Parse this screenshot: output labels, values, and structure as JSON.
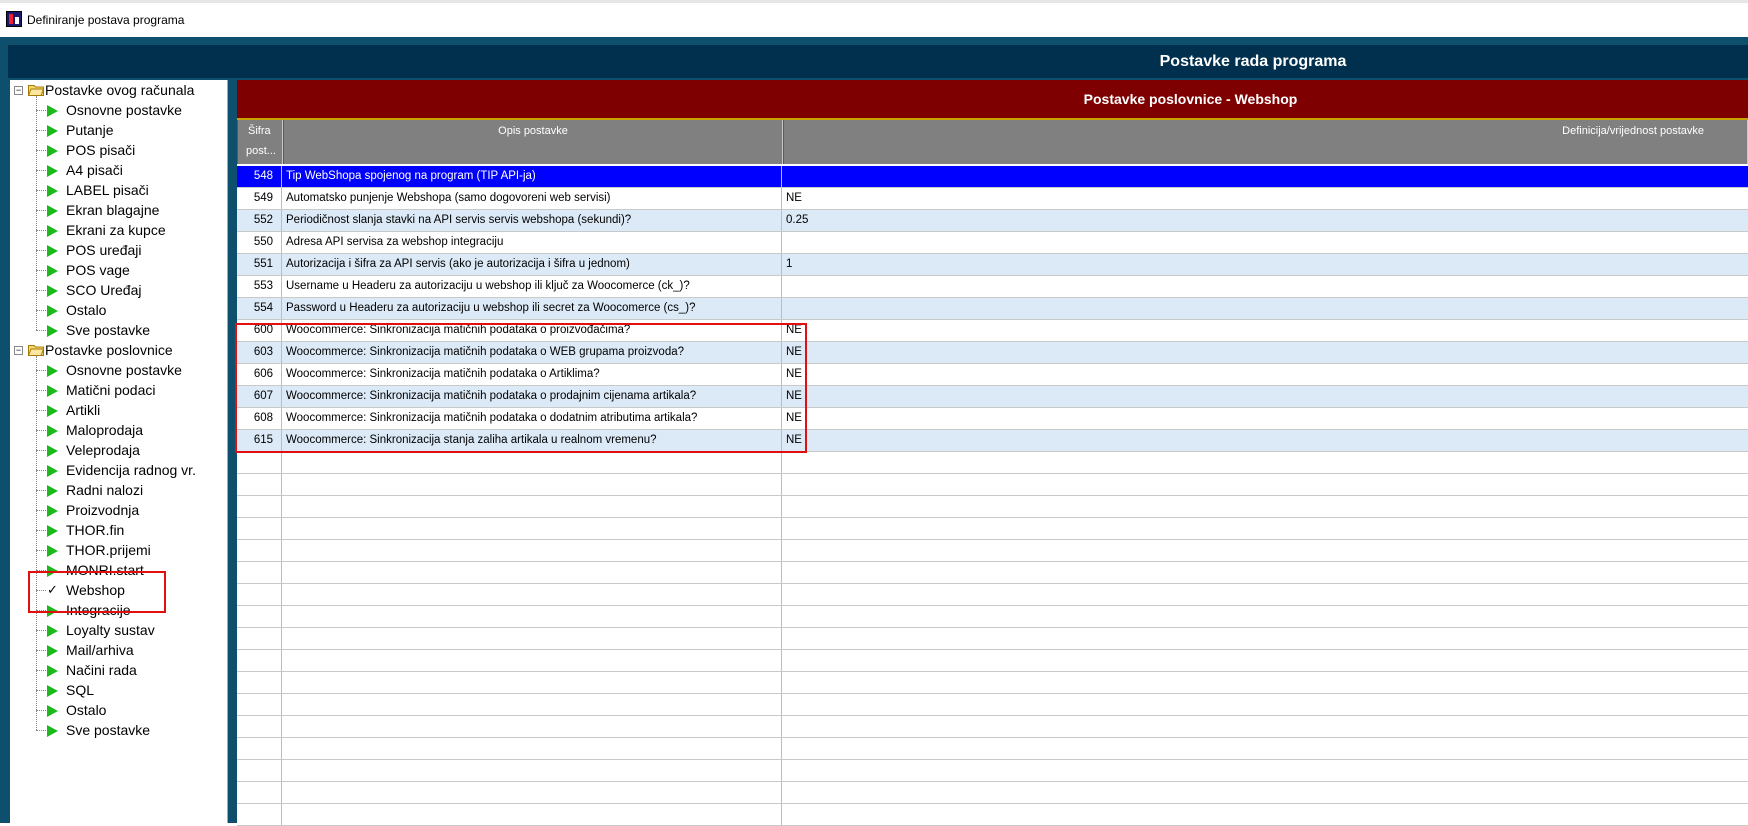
{
  "window": {
    "title": "Definiranje postava programa",
    "app_icon": "app-icon"
  },
  "header": {
    "title": "Postavke rada programa"
  },
  "tree": {
    "groups": [
      {
        "label": "Postavke ovog računala",
        "items": [
          {
            "label": "Osnovne postavke",
            "icon": "green-triangle-icon"
          },
          {
            "label": "Putanje",
            "icon": "green-triangle-icon"
          },
          {
            "label": "POS pisači",
            "icon": "green-triangle-icon"
          },
          {
            "label": "A4 pisači",
            "icon": "green-triangle-icon"
          },
          {
            "label": "LABEL pisači",
            "icon": "green-triangle-icon"
          },
          {
            "label": "Ekran blagajne",
            "icon": "green-triangle-icon"
          },
          {
            "label": "Ekrani za kupce",
            "icon": "green-triangle-icon"
          },
          {
            "label": "POS uređaji",
            "icon": "green-triangle-icon"
          },
          {
            "label": "POS vage",
            "icon": "green-triangle-icon"
          },
          {
            "label": "SCO Uređaj",
            "icon": "green-triangle-icon"
          },
          {
            "label": "Ostalo",
            "icon": "green-triangle-icon"
          },
          {
            "label": "Sve postavke",
            "icon": "green-triangle-icon"
          }
        ]
      },
      {
        "label": "Postavke poslovnice",
        "items": [
          {
            "label": "Osnovne postavke",
            "icon": "green-triangle-icon"
          },
          {
            "label": "Matični podaci",
            "icon": "green-triangle-icon"
          },
          {
            "label": "Artikli",
            "icon": "green-triangle-icon"
          },
          {
            "label": "Maloprodaja",
            "icon": "green-triangle-icon"
          },
          {
            "label": "Veleprodaja",
            "icon": "green-triangle-icon"
          },
          {
            "label": "Evidencija radnog vr.",
            "icon": "green-triangle-icon"
          },
          {
            "label": "Radni nalozi",
            "icon": "green-triangle-icon"
          },
          {
            "label": "Proizvodnja",
            "icon": "green-triangle-icon"
          },
          {
            "label": "THOR.fin",
            "icon": "green-triangle-icon"
          },
          {
            "label": "THOR.prijemi",
            "icon": "green-triangle-icon"
          },
          {
            "label": "MONRI.start",
            "icon": "green-triangle-icon"
          },
          {
            "label": "Webshop",
            "icon": "check-icon"
          },
          {
            "label": "Integracije",
            "icon": "green-triangle-icon"
          },
          {
            "label": "Loyalty sustav",
            "icon": "green-triangle-icon"
          },
          {
            "label": "Mail/arhiva",
            "icon": "green-triangle-icon"
          },
          {
            "label": "Načini rada",
            "icon": "green-triangle-icon"
          },
          {
            "label": "SQL",
            "icon": "green-triangle-icon"
          },
          {
            "label": "Ostalo",
            "icon": "green-triangle-icon"
          },
          {
            "label": "Sve postavke",
            "icon": "green-triangle-icon"
          }
        ]
      }
    ]
  },
  "panel": {
    "title": "Postavke poslovnice - Webshop",
    "columns": {
      "code_line1": "Šifra",
      "code_line2": "post...",
      "description": "Opis postavke",
      "value": "Definicija/vrijednost postavke"
    },
    "rows": [
      {
        "code": "548",
        "description": "Tip WebShopa spojenog na program (TIP API-ja)",
        "value": "",
        "state": "selected"
      },
      {
        "code": "549",
        "description": "Automatsko punjenje Webshopa (samo dogovoreni web servisi)",
        "value": "NE",
        "state": "normal"
      },
      {
        "code": "552",
        "description": "Periodičnost slanja stavki na API servis servis webshopa (sekundi)?",
        "value": "0.25",
        "state": "alt"
      },
      {
        "code": "550",
        "description": "Adresa API servisa za webshop integraciju",
        "value": "",
        "state": "normal"
      },
      {
        "code": "551",
        "description": "Autorizacija i šifra za API servis (ako je autorizacija i šifra u jednom)",
        "value": "1",
        "state": "alt"
      },
      {
        "code": "553",
        "description": "Username u Headeru za autorizaciju u webshop ili ključ za Woocomerce (ck_)?",
        "value": "",
        "state": "normal"
      },
      {
        "code": "554",
        "description": "Password u Headeru za autorizaciju u webshop ili secret za Woocomerce (cs_)?",
        "value": "",
        "state": "alt"
      },
      {
        "code": "600",
        "description": "Woocommerce: Sinkronizacija matičnih podataka o proizvođačima?",
        "value": "NE",
        "state": "normal"
      },
      {
        "code": "603",
        "description": "Woocommerce: Sinkronizacija matičnih podataka o WEB grupama proizvoda?",
        "value": "NE",
        "state": "alt"
      },
      {
        "code": "606",
        "description": "Woocommerce: Sinkronizacija matičnih podataka o Artiklima?",
        "value": "NE",
        "state": "normal"
      },
      {
        "code": "607",
        "description": "Woocommerce: Sinkronizacija matičnih podataka o prodajnim cijenama artikala?",
        "value": "NE",
        "state": "alt"
      },
      {
        "code": "608",
        "description": "Woocommerce: Sinkronizacija matičnih podataka o dodatnim atributima artikala?",
        "value": "NE",
        "state": "normal"
      },
      {
        "code": "615",
        "description": "Woocommerce: Sinkronizacija stanja zaliha artikala u realnom vremenu?",
        "value": "NE",
        "state": "alt"
      }
    ]
  },
  "colors": {
    "header_bg": "#00304d",
    "frame_bg": "#0f4f6e",
    "panel_title_bg": "#7f0000",
    "grid_head_bg": "#808080",
    "selected_row_bg": "#0000ff",
    "alt_row_bg": "#dce9f7",
    "highlight_box": "#e01010",
    "tree_icon": "#1db81d"
  }
}
